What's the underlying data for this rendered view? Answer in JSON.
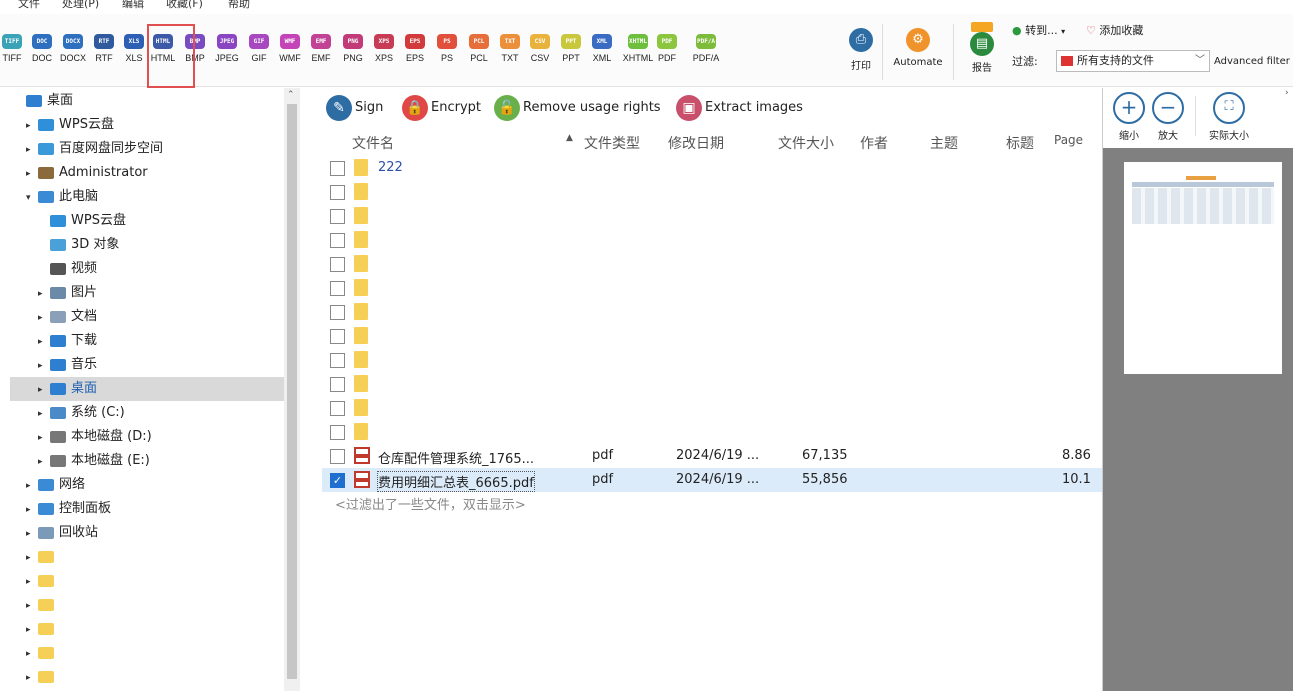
{
  "menu": [
    "文件",
    "处理(P)",
    "编辑",
    "收藏(F)",
    "帮助"
  ],
  "toolbar": {
    "formats": [
      {
        "label": "TIFF",
        "color": "#3aa3b8"
      },
      {
        "label": "DOC",
        "color": "#2f6fc0"
      },
      {
        "label": "DOCX",
        "color": "#2f6fc0"
      },
      {
        "label": "RTF",
        "color": "#2f5a9e"
      },
      {
        "label": "XLS",
        "color": "#2d5fb5"
      },
      {
        "label": "HTML",
        "color": "#3c5aa8"
      },
      {
        "label": "BMP",
        "color": "#7a4bc0"
      },
      {
        "label": "JPEG",
        "color": "#8a46c2"
      },
      {
        "label": "GIF",
        "color": "#a748c0"
      },
      {
        "label": "WMF",
        "color": "#c444b8"
      },
      {
        "label": "EMF",
        "color": "#c24296"
      },
      {
        "label": "PNG",
        "color": "#c23b79"
      },
      {
        "label": "XPS",
        "color": "#c73b55"
      },
      {
        "label": "EPS",
        "color": "#d23b3b"
      },
      {
        "label": "PS",
        "color": "#e0503a"
      },
      {
        "label": "PCL",
        "color": "#e66e3a"
      },
      {
        "label": "TXT",
        "color": "#eb8f3a"
      },
      {
        "label": "CSV",
        "color": "#e9b23a"
      },
      {
        "label": "PPT",
        "color": "#c9c83c"
      },
      {
        "label": "XML",
        "color": "#3b6cc4"
      },
      {
        "label": "XHTML",
        "color": "#6fbf3e"
      },
      {
        "label": "PDF",
        "color": "#8cc63f"
      },
      {
        "label": "PDF/A",
        "color": "#7dbb3a"
      }
    ],
    "print_label": "打印",
    "automate_label": "Automate",
    "report_label": "报告",
    "convert_label": "转到...",
    "favorite_label": "添加收藏",
    "filter_label": "过滤:",
    "filter_value": "所有支持的文件",
    "advanced_filter": "Advanced filter"
  },
  "tree": [
    {
      "label": "桌面",
      "indent": 0,
      "arrow": "",
      "color": "#2f7fd0"
    },
    {
      "label": "WPS云盘",
      "indent": 1,
      "arrow": "▸",
      "color": "#2f8fd8"
    },
    {
      "label": "百度网盘同步空间",
      "indent": 1,
      "arrow": "▸",
      "color": "#3a9ad9"
    },
    {
      "label": "Administrator",
      "indent": 1,
      "arrow": "▸",
      "color": "#8a6a3a"
    },
    {
      "label": "此电脑",
      "indent": 1,
      "arrow": "▾",
      "color": "#3a8ad6"
    },
    {
      "label": "WPS云盘",
      "indent": 2,
      "arrow": "",
      "color": "#2f8fd8"
    },
    {
      "label": "3D 对象",
      "indent": 2,
      "arrow": "",
      "color": "#4aa0d8"
    },
    {
      "label": "视频",
      "indent": 2,
      "arrow": "",
      "color": "#555555"
    },
    {
      "label": "图片",
      "indent": 2,
      "arrow": "▸",
      "color": "#6a8aa8"
    },
    {
      "label": "文档",
      "indent": 2,
      "arrow": "▸",
      "color": "#8aa0b8"
    },
    {
      "label": "下载",
      "indent": 2,
      "arrow": "▸",
      "color": "#2f7fd0"
    },
    {
      "label": "音乐",
      "indent": 2,
      "arrow": "▸",
      "color": "#2f7fd0"
    },
    {
      "label": "桌面",
      "indent": 2,
      "arrow": "▸",
      "color": "#2f7fd0"
    },
    {
      "label": "系统 (C:)",
      "indent": 2,
      "arrow": "▸",
      "color": "#4a8ac8"
    },
    {
      "label": "本地磁盘 (D:)",
      "indent": 2,
      "arrow": "▸",
      "color": "#777777"
    },
    {
      "label": "本地磁盘 (E:)",
      "indent": 2,
      "arrow": "▸",
      "color": "#777777"
    },
    {
      "label": "网络",
      "indent": 1,
      "arrow": "▸",
      "color": "#3a8ad6"
    },
    {
      "label": "控制面板",
      "indent": 1,
      "arrow": "▸",
      "color": "#3a8ad6"
    },
    {
      "label": "回收站",
      "indent": 1,
      "arrow": "▸",
      "color": "#7a9ab8"
    },
    {
      "label": "",
      "indent": 1,
      "arrow": "▸",
      "color": "#f6cf57"
    },
    {
      "label": "",
      "indent": 1,
      "arrow": "▸",
      "color": "#f6cf57"
    },
    {
      "label": "",
      "indent": 1,
      "arrow": "▸",
      "color": "#f6cf57"
    },
    {
      "label": "",
      "indent": 1,
      "arrow": "▸",
      "color": "#f6cf57"
    },
    {
      "label": "",
      "indent": 1,
      "arrow": "▸",
      "color": "#f6cf57"
    },
    {
      "label": "",
      "indent": 1,
      "arrow": "▸",
      "color": "#f6cf57"
    }
  ],
  "actions": [
    {
      "label": "Sign",
      "color": "#2e6da4",
      "glyph": "✎"
    },
    {
      "label": "Encrypt",
      "color": "#e04848",
      "glyph": "🔒"
    },
    {
      "label": "Remove usage rights",
      "color": "#6ab04a",
      "glyph": "🔓"
    },
    {
      "label": "Extract images",
      "color": "#c8506a",
      "glyph": "▣"
    }
  ],
  "columns": [
    "文件名",
    "文件类型",
    "修改日期",
    "文件大小",
    "作者",
    "主题",
    "标题",
    "Page"
  ],
  "files": [
    {
      "name": "222",
      "type": "",
      "date": "",
      "size": "",
      "pages": "",
      "kind": "folder",
      "checked": false
    },
    {
      "name": "",
      "type": "",
      "date": "",
      "size": "",
      "pages": "",
      "kind": "folder",
      "checked": false
    },
    {
      "name": "",
      "type": "",
      "date": "",
      "size": "",
      "pages": "",
      "kind": "folder",
      "checked": false
    },
    {
      "name": "",
      "type": "",
      "date": "",
      "size": "",
      "pages": "",
      "kind": "folder",
      "checked": false
    },
    {
      "name": "",
      "type": "",
      "date": "",
      "size": "",
      "pages": "",
      "kind": "folder",
      "checked": false
    },
    {
      "name": "",
      "type": "",
      "date": "",
      "size": "",
      "pages": "",
      "kind": "folder",
      "checked": false
    },
    {
      "name": "",
      "type": "",
      "date": "",
      "size": "",
      "pages": "",
      "kind": "folder",
      "checked": false
    },
    {
      "name": "",
      "type": "",
      "date": "",
      "size": "",
      "pages": "",
      "kind": "folder",
      "checked": false
    },
    {
      "name": "",
      "type": "",
      "date": "",
      "size": "",
      "pages": "",
      "kind": "folder",
      "checked": false
    },
    {
      "name": "",
      "type": "",
      "date": "",
      "size": "",
      "pages": "",
      "kind": "folder",
      "checked": false
    },
    {
      "name": "",
      "type": "",
      "date": "",
      "size": "",
      "pages": "",
      "kind": "folder",
      "checked": false
    },
    {
      "name": "",
      "type": "",
      "date": "",
      "size": "",
      "pages": "",
      "kind": "folder",
      "checked": false
    },
    {
      "name": "仓库配件管理系统_1765...",
      "type": "pdf",
      "date": "2024/6/19 ...",
      "size": "67,135",
      "pages": "8.86",
      "kind": "pdf",
      "checked": false
    },
    {
      "name": "费用明细汇总表_6665.pdf",
      "type": "pdf",
      "date": "2024/6/19 ...",
      "size": "55,856",
      "pages": "10.1",
      "kind": "pdf",
      "checked": true
    }
  ],
  "filter_notice": "<过滤出了一些文件，双击显示>",
  "preview": {
    "zoom_out_label": "缩小",
    "zoom_in_label": "放大",
    "actual_size_label": "实际大小"
  }
}
